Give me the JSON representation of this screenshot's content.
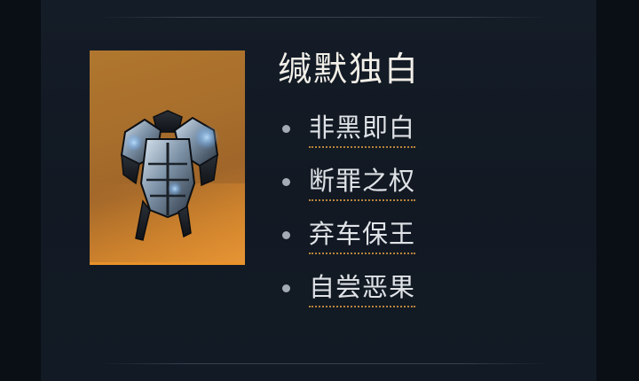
{
  "set": {
    "title": "缄默独白",
    "items": [
      {
        "label": "非黑即白"
      },
      {
        "label": "断罪之权"
      },
      {
        "label": "弃车保王"
      },
      {
        "label": "自尝恶果"
      }
    ]
  },
  "item_card": {
    "icon": "chest-armor-icon",
    "rarity_color": "#e8922b"
  }
}
